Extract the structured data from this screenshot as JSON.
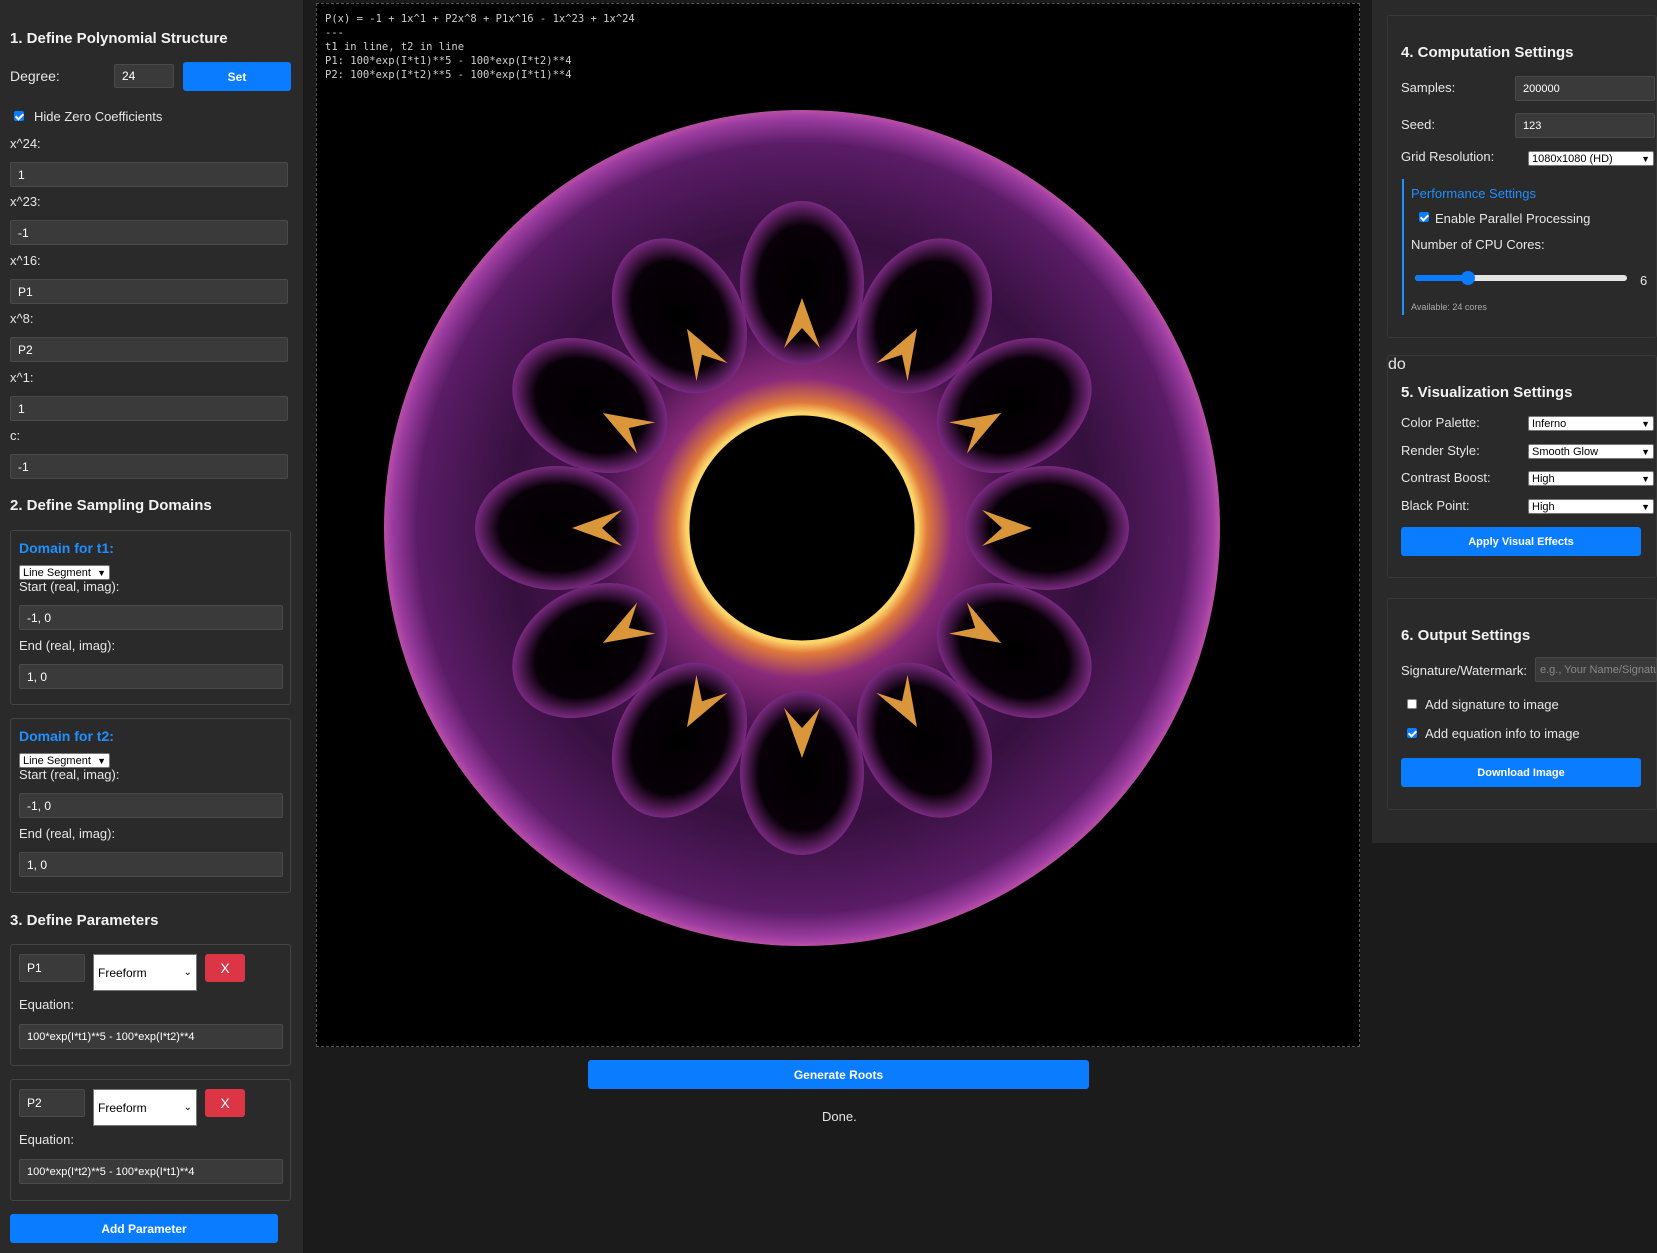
{
  "sections": {
    "s1": "1. Define Polynomial Structure",
    "s2": "2. Define Sampling Domains",
    "s3": "3. Define Parameters",
    "s4": "4. Computation Settings",
    "s5": "5. Visualization Settings",
    "s6": "6. Output Settings"
  },
  "degree": {
    "label": "Degree:",
    "value": "24",
    "set_label": "Set"
  },
  "hide_zero": {
    "label": "Hide Zero Coefficients",
    "checked": true
  },
  "coefficients": [
    {
      "label": "x^24:",
      "value": "1"
    },
    {
      "label": "x^23:",
      "value": "-1"
    },
    {
      "label": "x^16:",
      "value": "P1"
    },
    {
      "label": "x^8:",
      "value": "P2"
    },
    {
      "label": "x^1:",
      "value": "1"
    },
    {
      "label": "c:",
      "value": "-1"
    }
  ],
  "domains": [
    {
      "title": "Domain for t1:",
      "type": "Line Segment",
      "start_label": "Start (real, imag):",
      "start": "-1, 0",
      "end_label": "End (real, imag):",
      "end": "1, 0"
    },
    {
      "title": "Domain for t2:",
      "type": "Line Segment",
      "start_label": "Start (real, imag):",
      "start": "-1, 0",
      "end_label": "End (real, imag):",
      "end": "1, 0"
    }
  ],
  "parameters": [
    {
      "name": "P1",
      "mode": "Freeform",
      "remove": "X",
      "eq_label": "Equation:",
      "equation": "100*exp(I*t1)**5 - 100*exp(I*t2)**4"
    },
    {
      "name": "P2",
      "mode": "Freeform",
      "remove": "X",
      "eq_label": "Equation:",
      "equation": "100*exp(I*t2)**5 - 100*exp(I*t1)**4"
    }
  ],
  "add_parameter": "Add Parameter",
  "canvas": {
    "equation_info": "P(x) = -1 + 1x^1 + P2x^8 + P1x^16 - 1x^23 + 1x^24\n---\nt1 in line, t2 in line\nP1: 100*exp(I*t1)**5 - 100*exp(I*t2)**4\nP2: 100*exp(I*t2)**5 - 100*exp(I*t1)**4"
  },
  "generate_label": "Generate Roots",
  "status": "Done.",
  "computation": {
    "samples_label": "Samples:",
    "samples": "200000",
    "seed_label": "Seed:",
    "seed": "123",
    "grid_label": "Grid Resolution:",
    "grid": "1080x1080 (HD)",
    "perf_title": "Performance Settings",
    "parallel_label": "Enable Parallel Processing",
    "cores_label": "Number of CPU Cores:",
    "cores_value": "6",
    "cores_max": 24,
    "available": "Available: 24 cores"
  },
  "visualization": {
    "palette_label": "Color Palette:",
    "palette": "Inferno",
    "render_label": "Render Style:",
    "render": "Smooth Glow",
    "contrast_label": "Contrast Boost:",
    "contrast": "High",
    "black_label": "Black Point:",
    "black": "High",
    "apply_label": "Apply Visual Effects"
  },
  "output": {
    "sig_label": "Signature/Watermark:",
    "sig_placeholder": "e.g., Your Name/Signatu",
    "add_sig_label": "Add signature to image",
    "add_eq_label": "Add equation info to image",
    "download_label": "Download Image"
  },
  "colors": {
    "accent": "#0a7cff",
    "danger": "#dc3545",
    "link": "#1e90ff",
    "panel": "#2a2a2a",
    "background": "#1b1b1b"
  }
}
